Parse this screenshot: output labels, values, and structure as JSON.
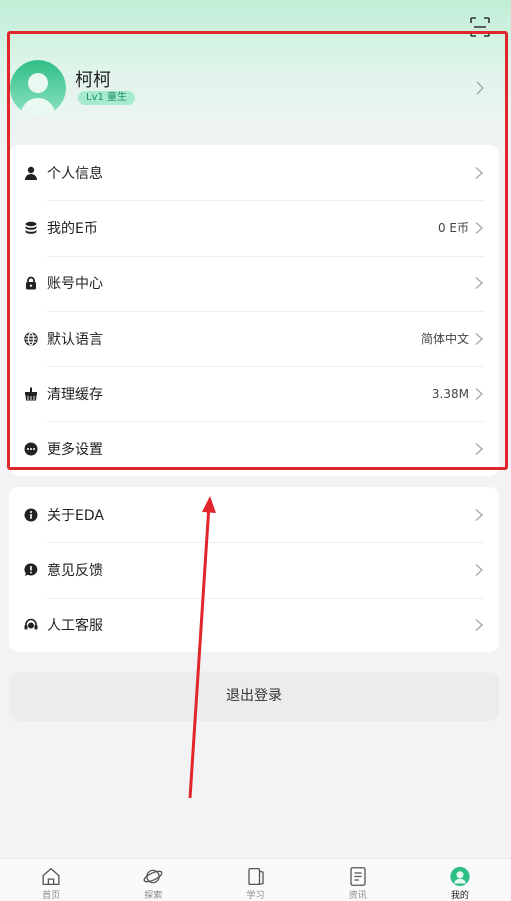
{
  "profile": {
    "name": "柯柯",
    "level": "Lv1 童生"
  },
  "settings_group": [
    {
      "key": "personal-info",
      "label": "个人信息",
      "value": "",
      "icon": "person-icon"
    },
    {
      "key": "my-ecoin",
      "label": "我的E币",
      "value": "0 E币",
      "icon": "coins-icon"
    },
    {
      "key": "account-center",
      "label": "账号中心",
      "value": "",
      "icon": "lock-icon"
    },
    {
      "key": "default-language",
      "label": "默认语言",
      "value": "简体中文",
      "icon": "globe-icon"
    },
    {
      "key": "clear-cache",
      "label": "清理缓存",
      "value": "3.38M",
      "icon": "broom-icon"
    },
    {
      "key": "more-settings",
      "label": "更多设置",
      "value": "",
      "icon": "more-icon"
    }
  ],
  "about_group": [
    {
      "key": "about-eda",
      "label": "关于EDA",
      "icon": "info-icon"
    },
    {
      "key": "feedback",
      "label": "意见反馈",
      "icon": "feedback-icon"
    },
    {
      "key": "customer-service",
      "label": "人工客服",
      "icon": "headset-icon"
    }
  ],
  "logout_label": "退出登录",
  "tabs": [
    {
      "key": "home",
      "label": "首页",
      "icon": "home-icon",
      "active": false
    },
    {
      "key": "explore",
      "label": "探索",
      "icon": "planet-icon",
      "active": false
    },
    {
      "key": "study",
      "label": "学习",
      "icon": "book-icon",
      "active": false
    },
    {
      "key": "news",
      "label": "资讯",
      "icon": "document-icon",
      "active": false
    },
    {
      "key": "mine",
      "label": "我的",
      "icon": "avatar-icon",
      "active": true
    }
  ],
  "colors": {
    "accent": "#1f8f63",
    "annotation": "#e0262a",
    "header_gradient_top": "#bfeed6"
  }
}
